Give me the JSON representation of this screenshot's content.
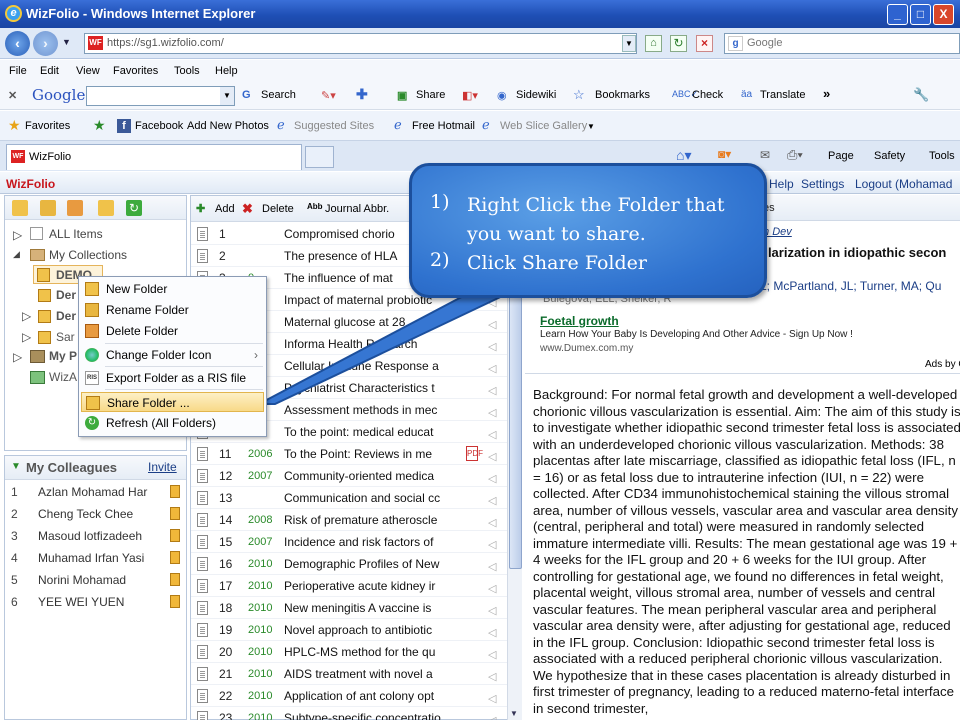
{
  "window": {
    "title": "WizFolio - Windows Internet Explorer",
    "min": "_",
    "max": "□",
    "close": "X"
  },
  "address": {
    "url": "https://sg1.wizfolio.com/",
    "search_placeholder": "Google"
  },
  "menu": [
    "File",
    "Edit",
    "View",
    "Favorites",
    "Tools",
    "Help"
  ],
  "google_toolbar": {
    "brand": "Google",
    "search": "Search",
    "share": "Share",
    "sidewiki": "Sidewiki",
    "bookmarks": "Bookmarks",
    "check": "Check",
    "translate": "Translate",
    "more": "»"
  },
  "favorites_bar": {
    "favorites": "Favorites",
    "items": [
      "Facebook",
      "Add New Photos",
      "Suggested Sites",
      "Free Hotmail",
      "Web Slice Gallery"
    ]
  },
  "tab": {
    "title": "WizFolio"
  },
  "command_bar": {
    "page": "Page",
    "safety": "Safety",
    "tools": "Tools"
  },
  "wizfolio_header": {
    "logo": "WizFolio",
    "help": "Help",
    "settings": "Settings",
    "logout": "Logout (Mohamad"
  },
  "collections_tree": {
    "all_items": "ALL Items",
    "my_collections": "My Collections",
    "demo": "DEMO",
    "folder2": "Der",
    "folder3": "Der",
    "folder4": "Sar",
    "my_p": "My P",
    "wizard": "WizA"
  },
  "context_menu": {
    "items": [
      "New Folder",
      "Rename Folder",
      "Delete Folder",
      "Change Folder Icon",
      "Export Folder as a RIS file",
      "Share Folder ...",
      "Refresh (All Folders)"
    ],
    "submenu_arrow": "›"
  },
  "colleagues": {
    "title": "My Colleagues",
    "invite": "Invite",
    "list": [
      {
        "n": "1",
        "name": "Azlan Mohamad Har"
      },
      {
        "n": "2",
        "name": "Cheng Teck Chee"
      },
      {
        "n": "3",
        "name": "Masoud lotfizadeeh"
      },
      {
        "n": "4",
        "name": "Muhamad Irfan Yasi"
      },
      {
        "n": "5",
        "name": "Norini Mohamad"
      },
      {
        "n": "6",
        "name": "YEE WEI YUEN"
      }
    ]
  },
  "list_toolbar": {
    "add": "Add",
    "delete": "Delete",
    "journal_abbr": "Journal Abbr."
  },
  "items": [
    {
      "n": "1",
      "yr": "",
      "title": "Compromised chorio"
    },
    {
      "n": "2",
      "yr": "",
      "title": "The presence of HLA"
    },
    {
      "n": "3",
      "yr": "0",
      "title": "The influence of mat"
    },
    {
      "n": "4",
      "yr": "",
      "title": "Impact of maternal probiotic"
    },
    {
      "n": "5",
      "yr": "",
      "title": "Maternal glucose at 28"
    },
    {
      "n": "6",
      "yr": "",
      "title": "Informa Health Research"
    },
    {
      "n": "7",
      "yr": "",
      "title": "Cellular Immune Response a"
    },
    {
      "n": "8",
      "yr": "",
      "title": "Psychiatrist Characteristics t"
    },
    {
      "n": "9",
      "yr": "7",
      "title": "Assessment methods in mec"
    },
    {
      "n": "10",
      "yr": "8",
      "title": "To the point: medical educat"
    },
    {
      "n": "11",
      "yr": "2006",
      "title": "To the Point: Reviews in me"
    },
    {
      "n": "12",
      "yr": "2007",
      "title": "Community-oriented medica"
    },
    {
      "n": "13",
      "yr": "",
      "title": "Communication and social cc"
    },
    {
      "n": "14",
      "yr": "2008",
      "title": "Risk of premature atheroscle"
    },
    {
      "n": "15",
      "yr": "2007",
      "title": "Incidence and risk factors of"
    },
    {
      "n": "16",
      "yr": "2010",
      "title": "Demographic Profiles of New"
    },
    {
      "n": "17",
      "yr": "2010",
      "title": "Perioperative acute kidney ir"
    },
    {
      "n": "18",
      "yr": "2010",
      "title": "New meningitis A vaccine is"
    },
    {
      "n": "19",
      "yr": "2010",
      "title": "Novel approach to antibiotic"
    },
    {
      "n": "20",
      "yr": "2010",
      "title": "HPLC-MS method for the qu"
    },
    {
      "n": "21",
      "yr": "2010",
      "title": "AIDS treatment with novel a"
    },
    {
      "n": "22",
      "yr": "2010",
      "title": "Application of ant colony opt"
    },
    {
      "n": "23",
      "yr": "2010",
      "title": "Subtype-specific concentratio"
    }
  ],
  "detail": {
    "tab_label": "tes",
    "author_link": "m Dev",
    "title": "ularization in idiopathic secon",
    "authors": "L; McPartland, JL; Turner, MA; Qu",
    "authors_prefix": "Bulegova, ELL, Sheiker, R",
    "ad_title": "Foetal growth",
    "ad_text": "Learn How Your Baby Is Developing And Other Advice - Sign Up Now !",
    "ad_url": "www.Dumex.com.my",
    "ads_by": "Ads by G",
    "abstract": "Background: For normal fetal growth and development a well-developed chorionic villous vascularization is essential. Aim: The aim of this study is to investigate whether idiopathic second trimester fetal loss is associated with an underdeveloped chorionic villous vascularization. Methods: 38 placentas after late miscarriage, classified as idiopathic fetal loss (IFL, n = 16) or as fetal loss due to intrauterine infection (IUI, n = 22) were collected. After CD34 immunohistochemical staining the villous stromal area, number of villous vessels, vascular area and vascular area density (central, peripheral and total) were measured in randomly selected immature intermediate villi. Results: The mean gestational age was 19 + 4 weeks for the IFL group and 20 + 6 weeks for the IUI group. After controlling for gestational age, we found no differences in fetal weight, placental weight, villous stromal area, number of vessels and central vascular features. The mean peripheral vascular area and peripheral vascular area density were, after adjusting for gestational age, reduced in the IFL group. Conclusion: Idiopathic second trimester fetal loss is associated with a reduced peripheral chorionic villous vascularization. We hypothesize that in these cases placentation is already disturbed in first trimester of pregnancy, leading to a reduced materno-fetal interface in second trimester,"
  },
  "callout": {
    "steps": [
      {
        "num": "1)",
        "text": "Right Click the Folder that you want to share."
      },
      {
        "num": "2)",
        "text": "Click Share Folder"
      }
    ]
  }
}
